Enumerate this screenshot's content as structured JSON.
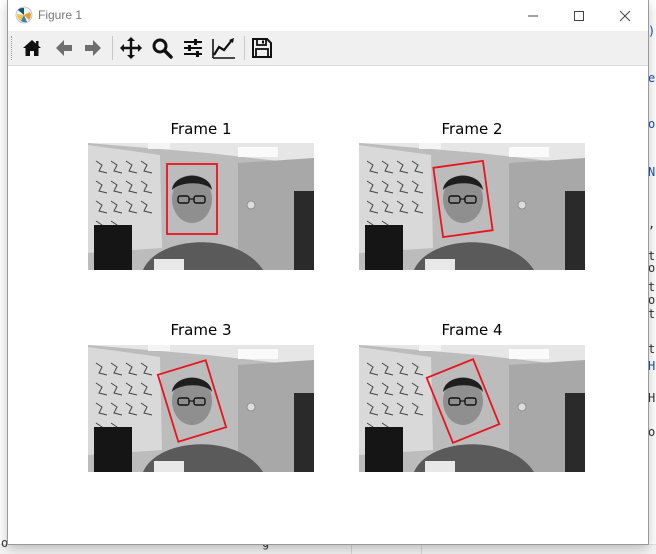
{
  "window": {
    "title": "Figure 1",
    "controls": [
      "minimize",
      "maximize",
      "close"
    ]
  },
  "toolbar": {
    "buttons": [
      {
        "name": "home-icon",
        "label": "Home"
      },
      {
        "name": "back-icon",
        "label": "Back"
      },
      {
        "name": "forward-icon",
        "label": "Forward"
      },
      {
        "name": "pan-icon",
        "label": "Pan"
      },
      {
        "name": "zoom-icon",
        "label": "Zoom"
      },
      {
        "name": "subplots-icon",
        "label": "Configure subplots"
      },
      {
        "name": "customize-icon",
        "label": "Edit axis"
      },
      {
        "name": "save-icon",
        "label": "Save"
      }
    ]
  },
  "figure": {
    "subplots": [
      {
        "title": "Frame 1",
        "box_color": "#e8141e",
        "box_rotation_deg": 0
      },
      {
        "title": "Frame 2",
        "box_color": "#e8141e",
        "box_rotation_deg": -8
      },
      {
        "title": "Frame 3",
        "box_color": "#e8141e",
        "box_rotation_deg": -17
      },
      {
        "title": "Frame 4",
        "box_color": "#e8141e",
        "box_rotation_deg": -22
      }
    ]
  },
  "background_editor": {
    "right_chars": [
      ")",
      "e",
      "o",
      "N",
      ",",
      "t",
      "o",
      "t",
      "o",
      "t",
      "t",
      "H",
      "H",
      "o"
    ],
    "bottom_left_char": "o",
    "bottom_mid_char": "g"
  }
}
